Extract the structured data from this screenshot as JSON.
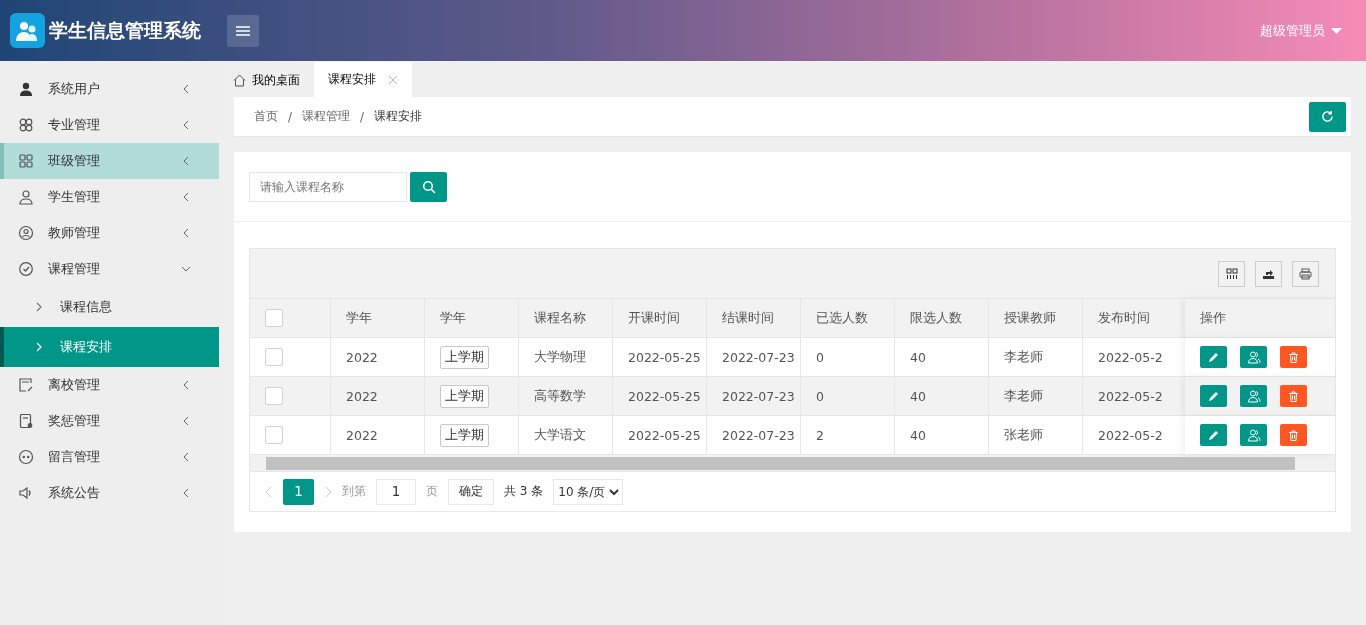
{
  "header": {
    "title": "学生信息管理系统",
    "user": "超级管理员"
  },
  "sidebar": {
    "items": [
      {
        "label": "系统用户",
        "expanded": false,
        "selected": false
      },
      {
        "label": "专业管理",
        "expanded": false,
        "selected": false
      },
      {
        "label": "班级管理",
        "expanded": false,
        "selected": true
      },
      {
        "label": "学生管理",
        "expanded": false,
        "selected": false
      },
      {
        "label": "教师管理",
        "expanded": false,
        "selected": false
      },
      {
        "label": "课程管理",
        "expanded": true,
        "selected": false,
        "children": [
          {
            "label": "课程信息",
            "selected": false
          },
          {
            "label": "课程安排",
            "selected": true
          }
        ]
      },
      {
        "label": "离校管理",
        "expanded": false,
        "selected": false
      },
      {
        "label": "奖惩管理",
        "expanded": false,
        "selected": false
      },
      {
        "label": "留言管理",
        "expanded": false,
        "selected": false
      },
      {
        "label": "系统公告",
        "expanded": false,
        "selected": false
      }
    ]
  },
  "tabs": [
    {
      "label": "我的桌面",
      "kind": "home",
      "selected": false
    },
    {
      "label": "课程安排",
      "kind": "closable",
      "selected": true
    }
  ],
  "breadcrumb": [
    {
      "label": "首页",
      "kind": "link"
    },
    {
      "label": "/",
      "kind": "separator"
    },
    {
      "label": "课程管理",
      "kind": "link"
    },
    {
      "label": "/",
      "kind": "separator"
    },
    {
      "label": "课程安排",
      "kind": "current"
    }
  ],
  "search": {
    "placeholder": "请输入课程名称"
  },
  "table": {
    "select_all": {
      "checked": false
    },
    "columns": [
      "学年",
      "学年",
      "课程名称",
      "开课时间",
      "结课时间",
      "已选人数",
      "限选人数",
      "授课教师",
      "发布时间",
      "操作"
    ],
    "rows": [
      {
        "checked": false,
        "cells": [
          "2022",
          "上学期",
          "大学物理",
          "2022-05-25",
          "2022-07-23",
          "0",
          "40",
          "李老师",
          "2022-05-2"
        ]
      },
      {
        "checked": false,
        "cells": [
          "2022",
          "上学期",
          "高等数学",
          "2022-05-25",
          "2022-07-23",
          "0",
          "40",
          "李老师",
          "2022-05-2"
        ]
      },
      {
        "checked": false,
        "cells": [
          "2022",
          "上学期",
          "大学语文",
          "2022-05-25",
          "2022-07-23",
          "2",
          "40",
          "张老师",
          "2022-05-2"
        ]
      }
    ]
  },
  "pager": {
    "pages": [
      {
        "label": "1",
        "selected": true
      }
    ],
    "goto_label": "到第",
    "goto_value": "1",
    "page_unit": "页",
    "confirm": "确定",
    "total": "共 3 条",
    "page_size": "10 条/页"
  }
}
